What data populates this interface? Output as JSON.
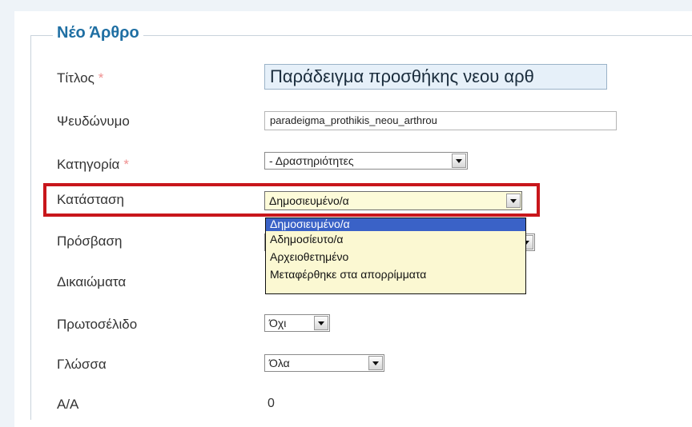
{
  "legend": "Νέο Άρθρο",
  "required_mark": "*",
  "labels": {
    "title": "Τίτλος",
    "alias": "Ψευδώνυμο",
    "category": "Κατηγορία",
    "status": "Κατάσταση",
    "access": "Πρόσβαση",
    "permissions": "Δικαιώματα",
    "featured": "Πρωτοσέλιδο",
    "language": "Γλώσσα",
    "id": "Α/Α"
  },
  "fields": {
    "title_value": "Παράδειγμα προσθήκης νεου αρθ",
    "alias_value": "paradeigma_prothikis_neou_arthrou",
    "category_value": "- Δραστηριότητες",
    "status_value": "Δημοσιευμένο/α",
    "featured_value": "Όχι",
    "language_value": "Όλα",
    "id_value": "0"
  },
  "status_options": [
    "Δημοσιευμένο/α",
    "Αδημοσίευτο/α",
    "Αρχειοθετημένο",
    "Μεταφέρθηκε στα απορρίμματα"
  ],
  "colors": {
    "highlight_border": "#c8161b",
    "legend": "#1f6fa3",
    "selected_option": "#3a62c7"
  }
}
